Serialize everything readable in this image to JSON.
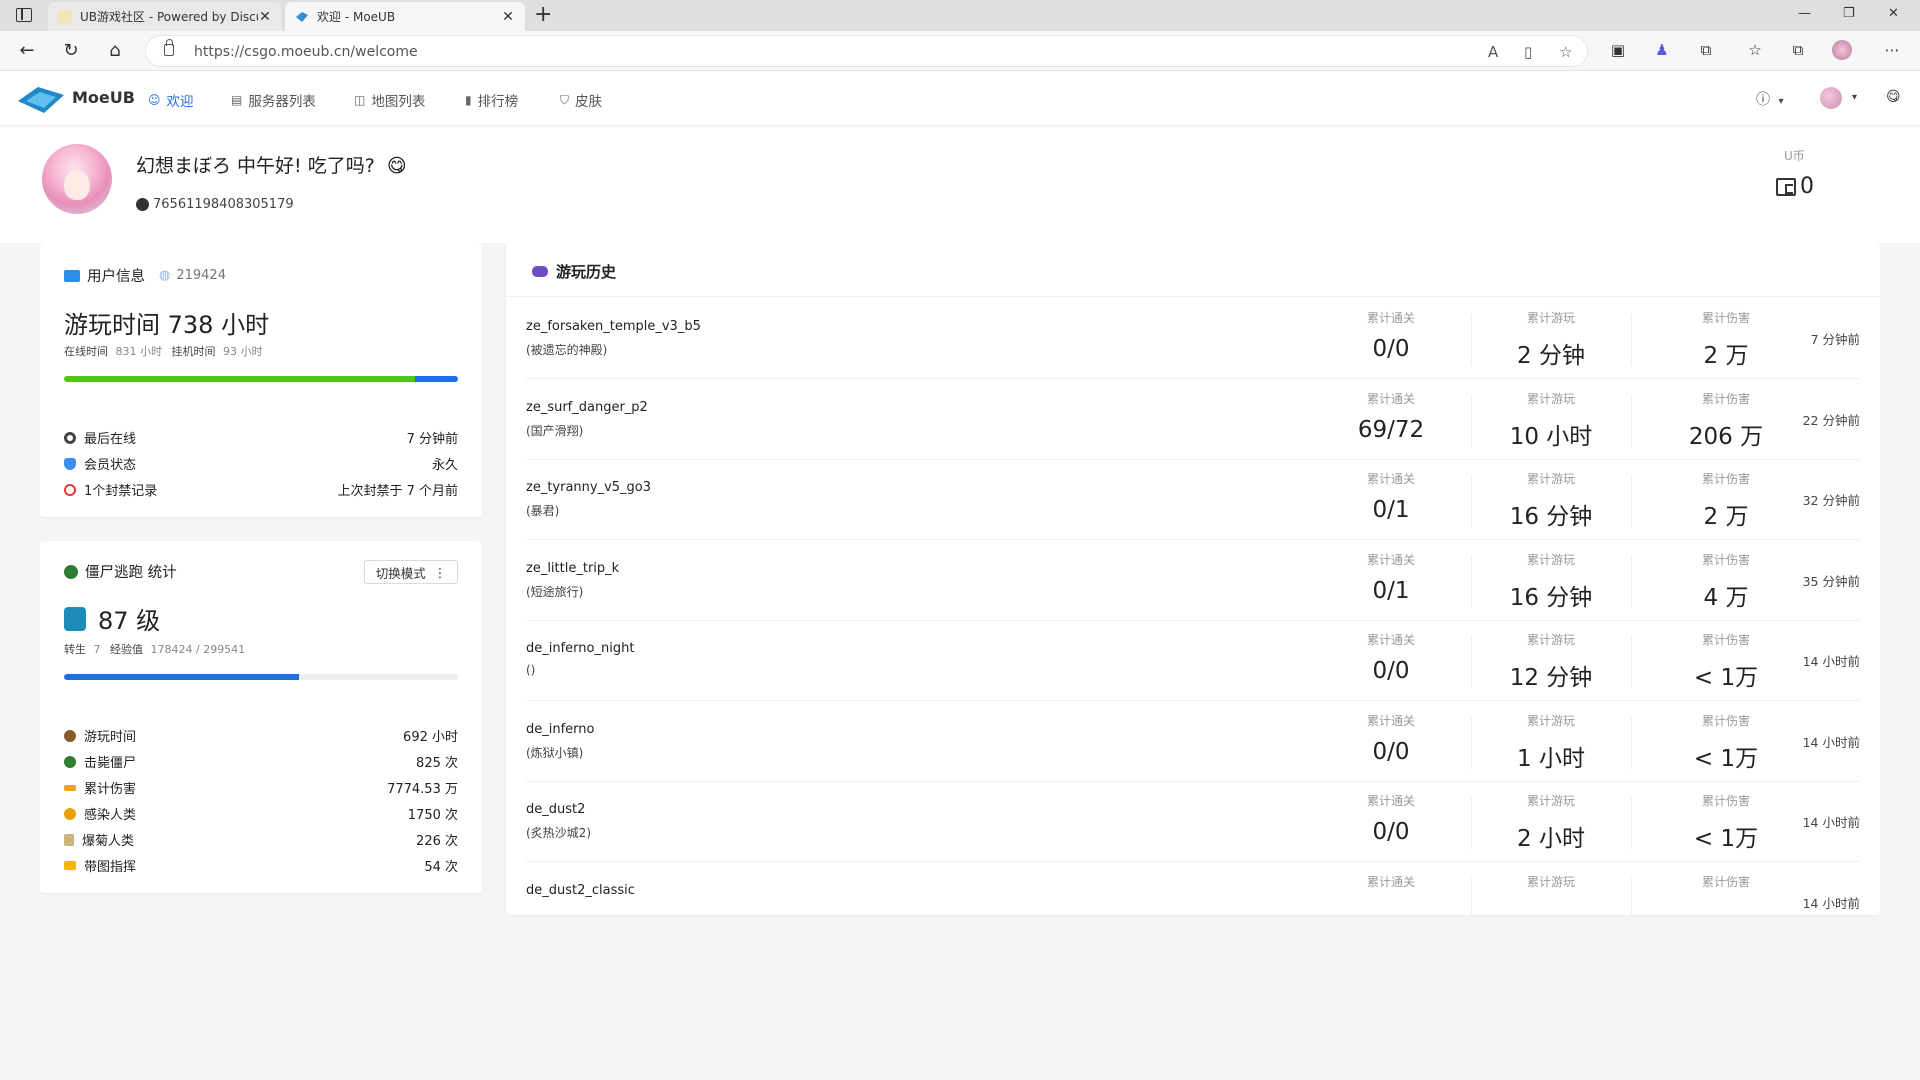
{
  "browser": {
    "tabs": [
      {
        "title": "UB游戏社区 - Powered by Discuz!",
        "active": false
      },
      {
        "title": "欢迎 - MoeUB",
        "active": true
      }
    ],
    "url": "https://csgo.moeub.cn/welcome"
  },
  "site": {
    "brand": "MoeUB",
    "nav": [
      {
        "label": "欢迎",
        "icon": "smile-icon",
        "active": true
      },
      {
        "label": "服务器列表",
        "icon": "list-icon",
        "active": false
      },
      {
        "label": "地图列表",
        "icon": "map-icon",
        "active": false
      },
      {
        "label": "排行榜",
        "icon": "bar-chart-icon",
        "active": false
      },
      {
        "label": "皮肤",
        "icon": "shirt-icon",
        "active": false
      }
    ],
    "accent": "#1f6fe6"
  },
  "profile": {
    "greeting": "幻想まぼろ 中午好! 吃了吗?",
    "greeting_emoji": "😋",
    "steam_id": "76561198408305179",
    "ucoin_label": "U币",
    "ucoin_value": "0"
  },
  "user_info": {
    "title": "用户信息",
    "uid": "219424",
    "playtime_title": "游玩时间 738 小时",
    "online_label": "在线时间",
    "online_value": "831 小时",
    "afk_label": "挂机时间",
    "afk_value": "93 小时",
    "online_fraction": 0.89,
    "afk_fraction": 0.11,
    "rows": [
      {
        "label": "最后在线",
        "value": "7 分钟前",
        "icon": "record-icon",
        "color": "#444"
      },
      {
        "label": "会员状态",
        "value": "永久",
        "icon": "shield-icon",
        "color": "#3b8ff3"
      },
      {
        "label": "1个封禁记录",
        "value": "上次封禁于 7 个月前",
        "icon": "ban-icon",
        "color": "#e53935"
      }
    ]
  },
  "zombie": {
    "title": "僵尸逃跑 统计",
    "mode_button": "切换模式",
    "level": "87 级",
    "rebirth_label": "转生",
    "rebirth_value": "7",
    "exp_label": "经验值",
    "exp_value": "178424 / 299541",
    "exp_fraction": 0.596,
    "rows": [
      {
        "label": "游玩时间",
        "value": "692 小时",
        "icon": "clock-icon",
        "color": "#8b5a2b"
      },
      {
        "label": "击毙僵尸",
        "value": "825 次",
        "icon": "zombie-icon",
        "color": "#2e7d32"
      },
      {
        "label": "累计伤害",
        "value": "7774.53 万",
        "icon": "gun-icon",
        "color": "#f0a020"
      },
      {
        "label": "感染人类",
        "value": "1750 次",
        "icon": "biohazard-icon",
        "color": "#e6a100"
      },
      {
        "label": "爆菊人类",
        "value": "226 次",
        "icon": "knife-icon",
        "color": "#c9b37a"
      },
      {
        "label": "带图指挥",
        "value": "54 次",
        "icon": "crown-icon",
        "color": "#f4b400"
      }
    ]
  },
  "history": {
    "title": "游玩历史",
    "labels": {
      "clears": "累计通关",
      "time": "累计游玩",
      "damage": "累计伤害"
    },
    "rows": [
      {
        "map": "ze_forsaken_temple_v3_b5",
        "cn": "(被遗忘的神殿)",
        "clears": "0/0",
        "time": "2 分钟",
        "damage": "2 万",
        "ago": "7 分钟前"
      },
      {
        "map": "ze_surf_danger_p2",
        "cn": "(国产滑翔)",
        "clears": "69/72",
        "time": "10 小时",
        "damage": "206 万",
        "ago": "22 分钟前"
      },
      {
        "map": "ze_tyranny_v5_go3",
        "cn": "(暴君)",
        "clears": "0/1",
        "time": "16 分钟",
        "damage": "2 万",
        "ago": "32 分钟前"
      },
      {
        "map": "ze_little_trip_k",
        "cn": "(短途旅行)",
        "clears": "0/1",
        "time": "16 分钟",
        "damage": "4 万",
        "ago": "35 分钟前"
      },
      {
        "map": "de_inferno_night",
        "cn": "()",
        "clears": "0/0",
        "time": "12 分钟",
        "damage": "< 1万",
        "ago": "14 小时前"
      },
      {
        "map": "de_inferno",
        "cn": "(炼狱小镇)",
        "clears": "0/0",
        "time": "1 小时",
        "damage": "< 1万",
        "ago": "14 小时前"
      },
      {
        "map": "de_dust2",
        "cn": "(炙热沙城2)",
        "clears": "0/0",
        "time": "2 小时",
        "damage": "< 1万",
        "ago": "14 小时前"
      },
      {
        "map": "de_dust2_classic",
        "cn": "",
        "clears": "",
        "time": "",
        "damage": "",
        "ago": "14 小时前"
      }
    ]
  }
}
